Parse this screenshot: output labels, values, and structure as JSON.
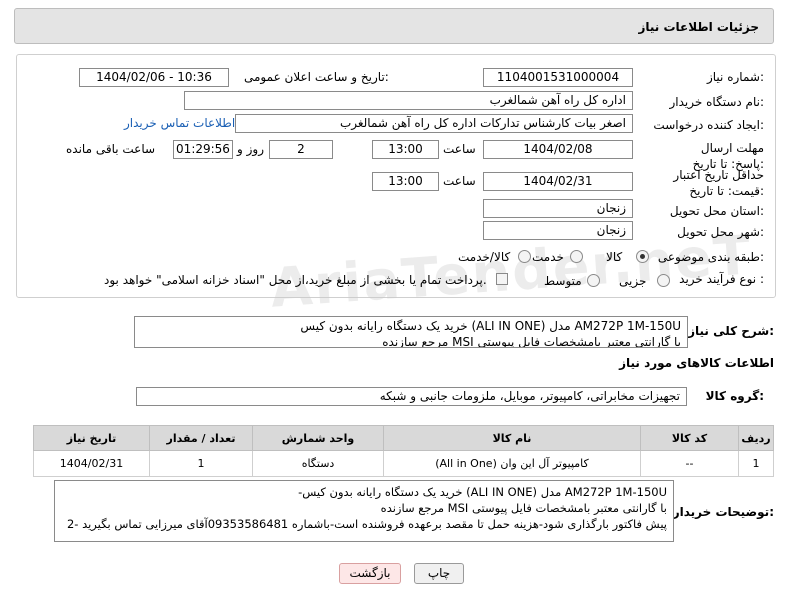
{
  "header": {
    "title": "جزئیات اطلاعات نیاز"
  },
  "fields": {
    "need_number_label": "شماره نیاز:",
    "need_number": "1104001531000004",
    "announce_label": "تاریخ و ساعت اعلان عمومی:",
    "announce_value": "1404/02/06 - 10:36",
    "buyer_org_label": "نام دستگاه خریدار:",
    "buyer_org": "اداره کل راه آهن شمالغرب",
    "creator_label": "ایجاد کننده درخواست:",
    "creator": "اصغر بیات کارشناس تدارکات اداره کل راه آهن شمالغرب",
    "contact_link": "اطلاعات تماس خریدار",
    "deadline_label": "مهلت ارسال پاسخ: تا تاریخ:",
    "deadline_date": "1404/02/08",
    "time_label": "ساعت",
    "deadline_time": "13:00",
    "days_value": "2",
    "days_label": "روز و",
    "remaining_time": "01:29:56",
    "remaining_label": "ساعت باقی مانده",
    "validity_label": "حداقل تاریخ اعتبار قیمت: تا تاریخ:",
    "validity_date": "1404/02/31",
    "validity_time": "13:00",
    "province_label": "استان محل تحویل:",
    "province": "زنجان",
    "city_label": "شهر محل تحویل:",
    "city": "زنجان",
    "category_label": "طبقه بندی موضوعی:",
    "cat_goods": "کالا",
    "cat_service": "خدمت",
    "cat_goods_service": "کالا/خدمت",
    "process_label": "نوع فرآیند خرید :",
    "proc_partial": "جزیی",
    "proc_medium": "متوسط",
    "payment_note": "پرداخت تمام یا بخشی از مبلغ خرید،از محل \"اسناد خزانه اسلامی\" خواهد بود."
  },
  "summary": {
    "label": "شرح کلی نیاز:",
    "line1": "خرید یک دستگاه رایانه بدون کیس (ALI IN ONE) مدل  AM272P 1M-150U",
    "line2": "مرجع سازنده MSI با گارانتی معتبر بامشخصات فایل پیوستی"
  },
  "goods_info": {
    "title": "اطلاعات کالاهای مورد نیاز",
    "group_label": "گروه کالا:",
    "group_value": "تجهیزات مخابراتی، کامپیوتر، موبایل، ملزومات جانبی و شبکه"
  },
  "table": {
    "headers": [
      "ردیف",
      "کد کالا",
      "نام کالا",
      "واحد شمارش",
      "تعداد / مقدار",
      "تاریخ نیاز"
    ],
    "rows": [
      [
        "1",
        "--",
        "کامپیوتر آل این وان (All in One)",
        "دستگاه",
        "1",
        "1404/02/31"
      ]
    ]
  },
  "buyer_notes": {
    "label": "توضیحات خریدار:",
    "line1": "-خرید یک دستگاه رایانه بدون کیس (ALI IN ONE) مدل  AM272P 1M-150U",
    "line2": "مرجع سازنده MSI با گارانتی معتبر بامشخصات فایل پیوستی",
    "line3": "2- پیش فاکتور بارگذاری شود-هزینه حمل تا مقصد برعهده فروشنده است-باشماره 09353586481آقای میرزایی تماس بگیرید"
  },
  "buttons": {
    "print": "چاپ",
    "back": "بازگشت"
  },
  "watermark": "AriaTender.neT"
}
